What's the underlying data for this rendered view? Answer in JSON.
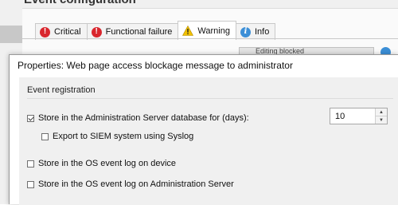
{
  "background": {
    "header_title": "Event configuration",
    "tabs": [
      {
        "label": "Critical",
        "icon": "critical-icon"
      },
      {
        "label": "Functional failure",
        "icon": "functional-failure-icon"
      },
      {
        "label": "Warning",
        "icon": "warning-icon",
        "active": true
      },
      {
        "label": "Info",
        "icon": "info-icon"
      }
    ],
    "field_partial_text": "Editing blocked"
  },
  "dialog": {
    "title": "Properties: Web page access blockage message to administrator",
    "section_title": "Event registration",
    "options": {
      "store_admin_db": {
        "label": "Store in the Administration Server database for (days):",
        "checked": true
      },
      "days_value": "10",
      "export_siem": {
        "label": "Export to SIEM system using Syslog",
        "checked": false
      },
      "store_os_device": {
        "label": "Store in the OS event log on device",
        "checked": false
      },
      "store_os_admin": {
        "label": "Store in the OS event log on Administration Server",
        "checked": false
      }
    }
  },
  "colors": {
    "critical": "#d9262d",
    "info": "#3c8fd7",
    "warning": "#f2c200"
  }
}
